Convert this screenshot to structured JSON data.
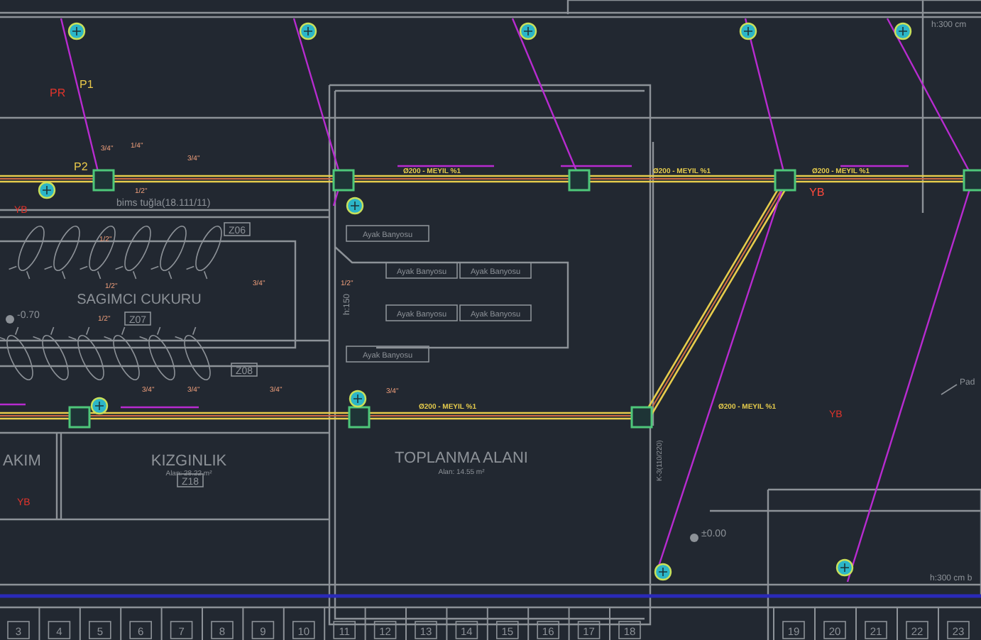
{
  "rooms": [
    {
      "name": "SAGIMCI CUKURU",
      "code": "Z07"
    },
    {
      "name": "AKIM"
    },
    {
      "name": "KIZGINLIK",
      "area": "Alan: 28.22 m²",
      "code": "Z18"
    },
    {
      "name": "TOPLANMA ALANI",
      "area": "Alan: 14.55 m²"
    }
  ],
  "zone_codes": [
    "Z06",
    "Z08"
  ],
  "wall_label": "bims tuğla(18.111/11)",
  "footbaths": [
    "Ayak Banyosu",
    "Ayak Banyosu",
    "Ayak Banyosu",
    "Ayak Banyosu",
    "Ayak Banyosu",
    "Ayak Banyosu"
  ],
  "levels": [
    "-0.70",
    "±0.00"
  ],
  "heights": [
    "h:150",
    "h:300 cm",
    "h:300 cm b"
  ],
  "vertical_label": "K-3(110/220)",
  "side_label": "Pad",
  "pipe_labels": [
    "Ø200 - MEYIL %1",
    "Ø200 - MEYIL %1",
    "Ø200 - MEYIL %1",
    "Ø200 - MEYIL %1",
    "Ø200 - MEYIL %1"
  ],
  "pipe_sizes": [
    "3/4\"",
    "1/4\"",
    "3/4\"",
    "1/2\"",
    "1/2\"",
    "1/2\"",
    "3/4\"",
    "1/2\"",
    "1/2\"",
    "3/4\"",
    "3/4\"",
    "3/4\"",
    "3/4\""
  ],
  "markers": [
    "PR",
    "P1",
    "P2",
    "YB",
    "YB",
    "YB",
    "YB"
  ],
  "stalls": [
    "3",
    "4",
    "5",
    "6",
    "7",
    "8",
    "9",
    "10",
    "11",
    "12",
    "13",
    "14",
    "15",
    "16",
    "17",
    "18",
    "19",
    "20",
    "21",
    "22",
    "23"
  ]
}
